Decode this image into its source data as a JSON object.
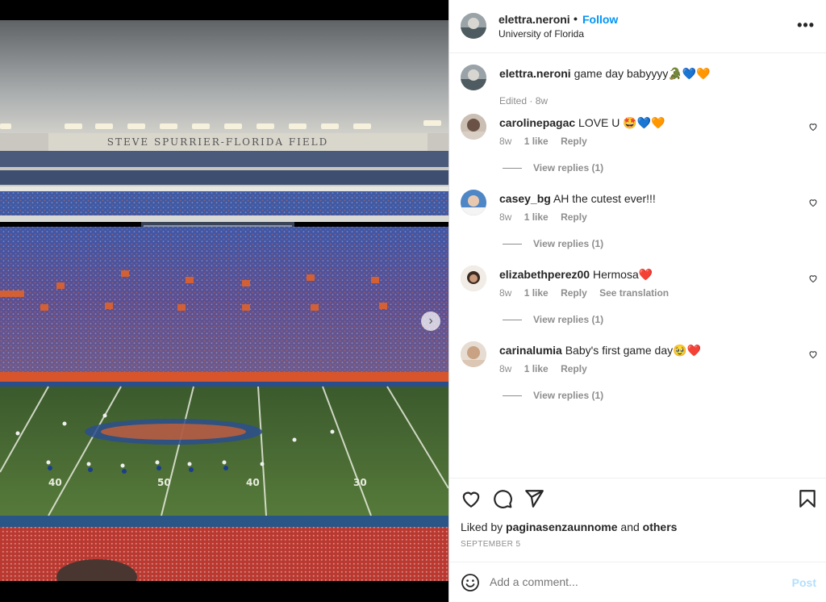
{
  "post": {
    "username": "elettra.neroni",
    "follow_label": "Follow",
    "separator": "•",
    "location": "University of Florida",
    "more_label": "•••",
    "photo_stadium_text": "STEVE SPURRIER-FLORIDA FIELD",
    "next_arrow": "›"
  },
  "caption": {
    "username": "elettra.neroni",
    "text": "game day babyyyy🐊💙🧡",
    "edited": "Edited",
    "dot": "·",
    "time": "8w"
  },
  "comments": [
    {
      "username": "carolinepagac",
      "text": "LOVE U 🤩💙🧡",
      "time": "8w",
      "likes": "1 like",
      "reply": "Reply",
      "translate": "",
      "view_replies": "View replies (1)"
    },
    {
      "username": "casey_bg",
      "text": "AH the cutest ever!!!",
      "time": "8w",
      "likes": "1 like",
      "reply": "Reply",
      "translate": "",
      "view_replies": "View replies (1)"
    },
    {
      "username": "elizabethperez00",
      "text": "Hermosa❤️",
      "time": "8w",
      "likes": "1 like",
      "reply": "Reply",
      "translate": "See translation",
      "view_replies": "View replies (1)"
    },
    {
      "username": "carinalumia",
      "text": "Baby's first game day🥹❤️",
      "time": "8w",
      "likes": "1 like",
      "reply": "Reply",
      "translate": "",
      "view_replies": "View replies (1)"
    }
  ],
  "likes": {
    "prefix": "Liked by",
    "user": "paginasenzaunnome",
    "and": "and",
    "others": "others"
  },
  "date": "SEPTEMBER 5",
  "add_comment": {
    "placeholder": "Add a comment...",
    "post_label": "Post"
  },
  "colors": {
    "accent": "#0095f6",
    "post_disabled": "#b2dffc",
    "secondary_text": "#8e8e8e"
  },
  "icons": [
    "more-options-icon",
    "heart-icon",
    "comment-icon",
    "share-icon",
    "bookmark-icon",
    "emoji-icon",
    "next-arrow-icon"
  ]
}
